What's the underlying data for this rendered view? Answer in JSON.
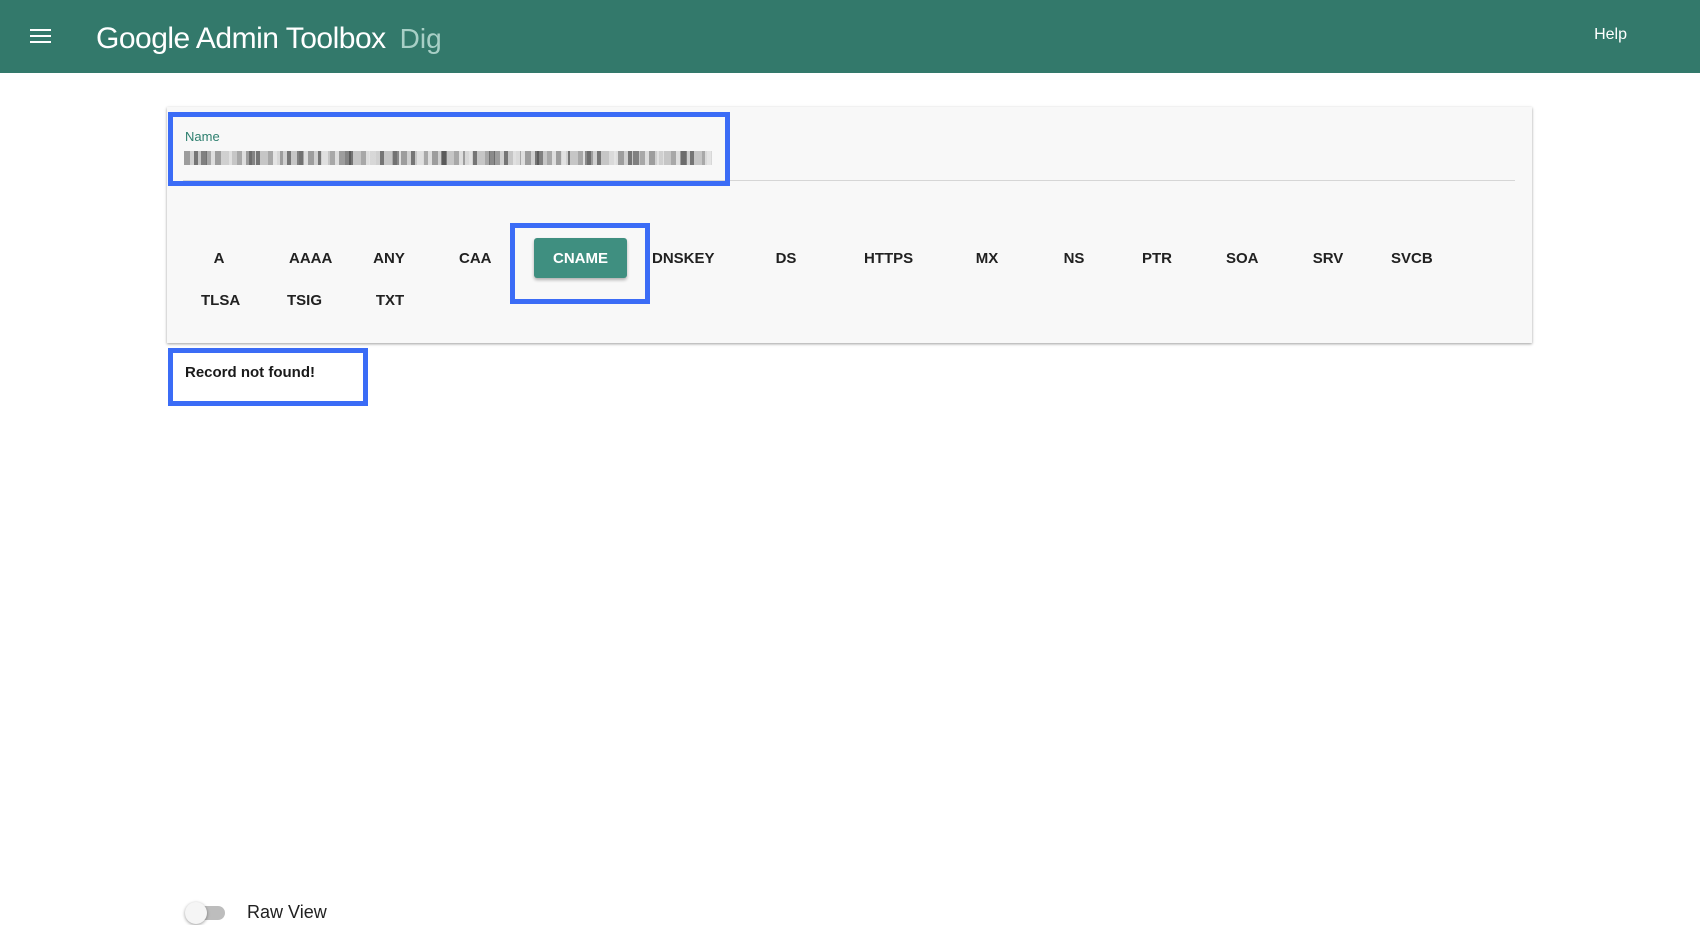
{
  "header": {
    "title": "Google Admin Toolbox",
    "subtitle": "Dig",
    "help_label": "Help"
  },
  "query": {
    "name_label": "Name",
    "name_value": ""
  },
  "record_types": [
    "A",
    "AAAA",
    "ANY",
    "CAA",
    "CNAME",
    "DNSKEY",
    "DS",
    "HTTPS",
    "MX",
    "NS",
    "PTR",
    "SOA",
    "SRV",
    "SVCB",
    "TLSA",
    "TSIG",
    "TXT"
  ],
  "selected_type": "CNAME",
  "result": {
    "message": "Record not found!"
  },
  "raw_view": {
    "label": "Raw View",
    "enabled": false
  },
  "colors": {
    "header_bg": "#33796b",
    "active_button": "#3f8f80",
    "highlight_box": "#3b6cf6"
  }
}
